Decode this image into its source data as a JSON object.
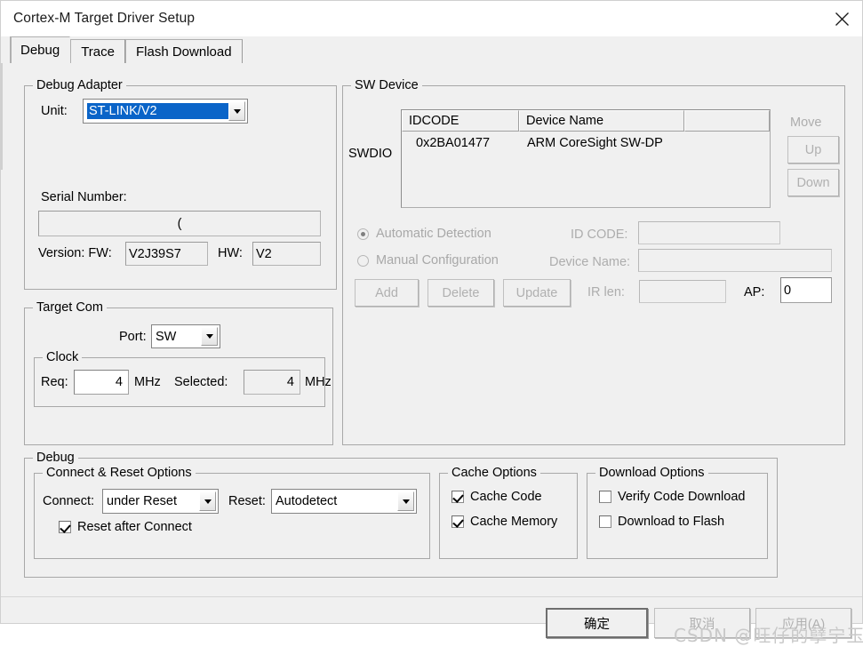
{
  "window": {
    "title": "Cortex-M Target Driver Setup",
    "close_label": "×"
  },
  "tabs": [
    {
      "label": "Debug",
      "active": true
    },
    {
      "label": "Trace",
      "active": false
    },
    {
      "label": "Flash Download",
      "active": false
    }
  ],
  "debug_adapter": {
    "title": "Debug Adapter",
    "unit_label": "Unit:",
    "unit_value": "ST-LINK/V2",
    "serial_label": "Serial Number:",
    "serial_value": "(",
    "version_label": "Version: FW:",
    "fw_value": "V2J39S7",
    "hw_label": "HW:",
    "hw_value": "V2"
  },
  "target_com": {
    "title": "Target Com",
    "port_label": "Port:",
    "port_value": "SW",
    "clock_title": "Clock",
    "req_label": "Req:",
    "req_value": "4",
    "req_unit": "MHz",
    "selected_label": "Selected:",
    "selected_value": "4",
    "selected_unit": "MHz"
  },
  "sw_device": {
    "title": "SW Device",
    "swdio_label": "SWDIO",
    "columns": [
      "IDCODE",
      "Device Name",
      ""
    ],
    "rows": [
      {
        "idcode": "0x2BA01477",
        "device_name": "ARM CoreSight SW-DP",
        "extra": ""
      }
    ],
    "move_label": "Move",
    "up_label": "Up",
    "down_label": "Down",
    "automatic_detection_label": "Automatic Detection",
    "manual_configuration_label": "Manual Configuration",
    "id_code_label": "ID CODE:",
    "id_code_value": "",
    "device_name_label": "Device Name:",
    "device_name_value": "",
    "add_label": "Add",
    "delete_label": "Delete",
    "update_label": "Update",
    "ir_len_label": "IR len:",
    "ir_len_value": "",
    "ap_label": "AP:",
    "ap_value": "0"
  },
  "debug_section": {
    "title": "Debug",
    "connect_reset": {
      "title": "Connect & Reset Options",
      "connect_label": "Connect:",
      "connect_value": "under Reset",
      "reset_label": "Reset:",
      "reset_value": "Autodetect",
      "reset_after_connect_label": "Reset after Connect",
      "reset_after_connect_checked": true
    },
    "cache_options": {
      "title": "Cache Options",
      "items": [
        {
          "label": "Cache Code",
          "checked": true
        },
        {
          "label": "Cache Memory",
          "checked": true
        }
      ]
    },
    "download_options": {
      "title": "Download Options",
      "items": [
        {
          "label": "Verify Code Download",
          "checked": false
        },
        {
          "label": "Download to Flash",
          "checked": false
        }
      ]
    }
  },
  "footer": {
    "ok_label": "确定",
    "cancel_label": "取消",
    "apply_label": "应用(A)",
    "watermark": "CSDN @旺仔的孽宁玉"
  },
  "colors": {
    "selection_blue": "#0a64c8",
    "dialog_face": "#f0f0f0",
    "disabled_text": "#a8a8a8"
  }
}
